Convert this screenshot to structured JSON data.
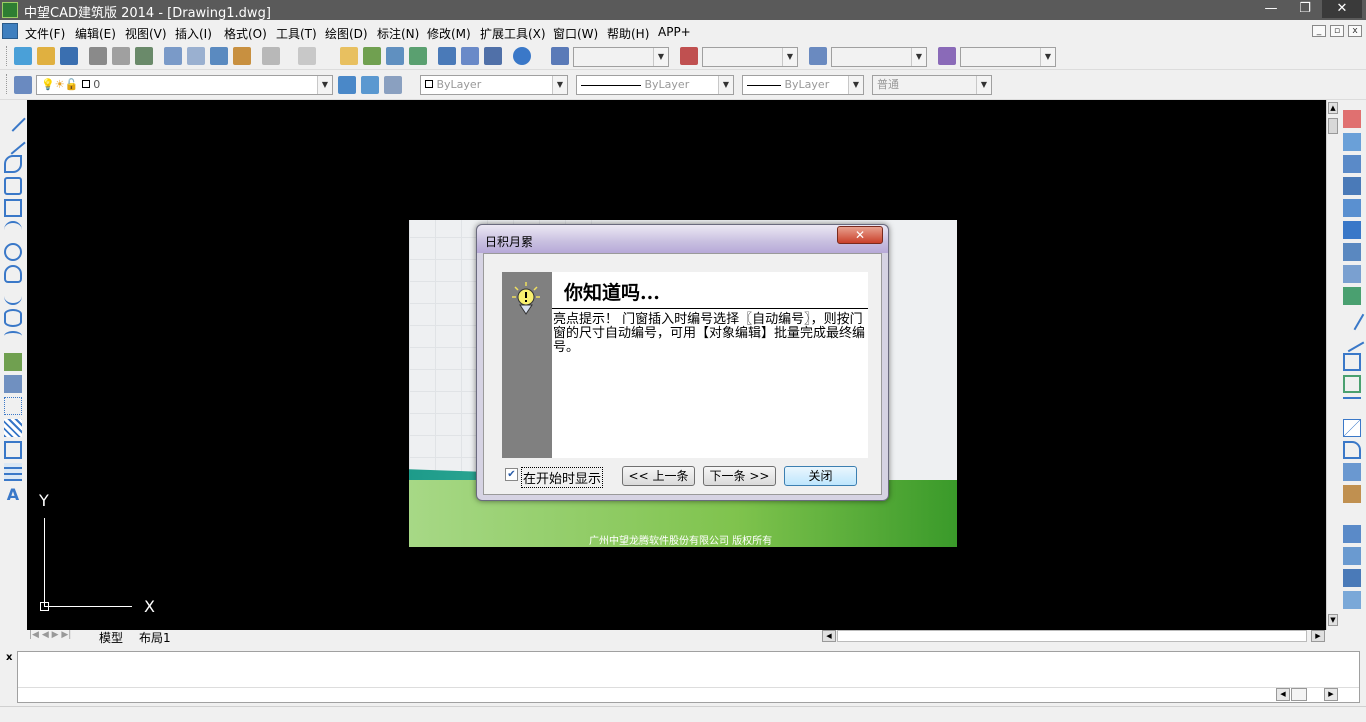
{
  "window": {
    "title": "中望CAD建筑版 2014 - [Drawing1.dwg]",
    "min_glyph": "—",
    "max_glyph": "❐",
    "close_glyph": "✕"
  },
  "menu": {
    "items": [
      "文件(F)",
      "编辑(E)",
      "视图(V)",
      "插入(I)",
      "格式(O)",
      "工具(T)",
      "绘图(D)",
      "标注(N)",
      "修改(M)",
      "扩展工具(X)",
      "窗口(W)",
      "帮助(H)",
      "APP+"
    ],
    "mdi_min": "_",
    "mdi_restore": "▫",
    "mdi_close": "x"
  },
  "layer_toolbar": {
    "layer_name": "0",
    "color_value": "ByLayer",
    "linetype_value": "ByLayer",
    "lineweight_value": "ByLayer",
    "plotstyle_value": "普通"
  },
  "ucs": {
    "y_label": "Y",
    "x_label": "X"
  },
  "layout_tabs": {
    "model": "模型",
    "layout1": "布局1"
  },
  "splash": {
    "copyright": "广州中望龙腾软件股份有限公司 版权所有"
  },
  "dialog": {
    "title": "日积月累",
    "close_glyph": "✕",
    "heading": "你知道吗...",
    "tip_text": "亮点提示！ 门窗插入时编号选择〖自动编号〗，则按门窗的尺寸自动编号，可用【对象编辑】批量完成最终编号。",
    "checkbox_label": "在开始时显示",
    "checkbox_checked": true,
    "prev_label": "<< 上一条",
    "next_label": "下一条 >>",
    "close_label": "关闭"
  },
  "command": {
    "close_glyph": "x"
  },
  "colors": {
    "titlebar": "#5a5a5a",
    "canvas": "#000000",
    "tip_sidebar": "#808080",
    "dialog_frame": "#d6d3e3"
  }
}
